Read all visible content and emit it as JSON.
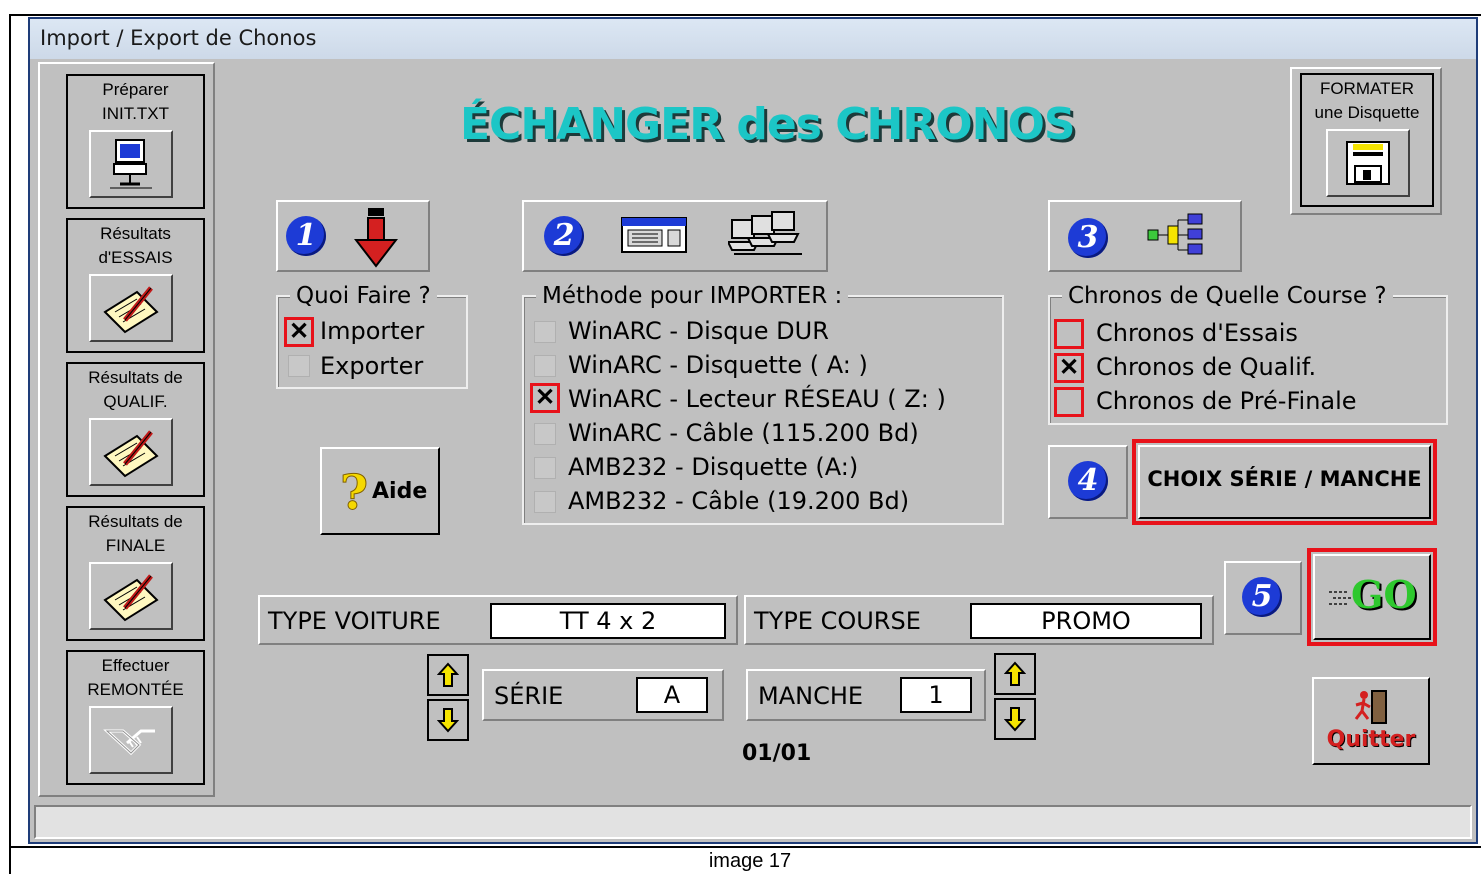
{
  "window": {
    "title": "Import / Export de Chonos"
  },
  "sidebar": {
    "items": [
      {
        "label": "Préparer\nINIT.TXT",
        "icon": "computer-icon"
      },
      {
        "label": "Résultats\nd'ESSAIS",
        "icon": "pencil-note-icon"
      },
      {
        "label": "Résultats de\nQUALIF.",
        "icon": "pencil-note-icon"
      },
      {
        "label": "Résultats de\nFINALE",
        "icon": "pencil-note-icon"
      },
      {
        "label": "Effectuer\nREMONTÉE",
        "icon": "handshake-icon"
      }
    ]
  },
  "heading": "ÉCHANGER des CHRONOS",
  "format_button": {
    "label": "FORMATER\nune Disquette",
    "icon": "floppy-disk-icon"
  },
  "steps": {
    "one": "1",
    "two": "2",
    "three": "3",
    "four": "4",
    "five": "5"
  },
  "quoi_faire": {
    "title": "Quoi Faire ?",
    "options": [
      {
        "label": "Importer",
        "checked": true
      },
      {
        "label": "Exporter",
        "checked": false
      }
    ]
  },
  "methode": {
    "title": "Méthode pour IMPORTER :",
    "options": [
      {
        "label": "WinARC - Disque DUR",
        "checked": false
      },
      {
        "label": "WinARC - Disquette ( A: )",
        "checked": false
      },
      {
        "label": "WinARC - Lecteur RÉSEAU ( Z: )",
        "checked": true
      },
      {
        "label": "WinARC - Câble (115.200 Bd)",
        "checked": false
      },
      {
        "label": "AMB232 - Disquette (A:)",
        "checked": false
      },
      {
        "label": "AMB232 - Câble (19.200 Bd)",
        "checked": false
      }
    ]
  },
  "course": {
    "title": "Chronos de Quelle Course ?",
    "options": [
      {
        "label": "Chronos d'Essais",
        "checked": false
      },
      {
        "label": "Chronos de Qualif.",
        "checked": true
      },
      {
        "label": "Chronos de Pré-Finale",
        "checked": false
      }
    ]
  },
  "aide_button": {
    "label": "Aide"
  },
  "choix_button": {
    "label": "CHOIX SÉRIE / MANCHE"
  },
  "go_button": {
    "label": "GO"
  },
  "quitter_button": {
    "label": "Quitter"
  },
  "type_voiture": {
    "label": "TYPE VOITURE",
    "value": "TT 4 x 2"
  },
  "type_course": {
    "label": "TYPE COURSE",
    "value": "PROMO"
  },
  "serie": {
    "label": "SÉRIE",
    "value": "A"
  },
  "manche": {
    "label": "MANCHE",
    "value": "1"
  },
  "page_indicator": "01/01",
  "caption": "image 17",
  "colors": {
    "face": "#c0c0c0",
    "highlight_red": "#e8121a",
    "title_cyan": "#1cc6c6",
    "step_blue": "#1d3bd6"
  }
}
